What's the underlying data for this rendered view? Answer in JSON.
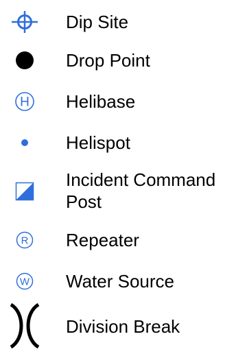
{
  "legend": {
    "items": [
      {
        "symbol": "dip-site-icon",
        "label": "Dip Site"
      },
      {
        "symbol": "drop-point-icon",
        "label": "Drop Point"
      },
      {
        "symbol": "helibase-icon",
        "label": "Helibase",
        "glyph": "H"
      },
      {
        "symbol": "helispot-icon",
        "label": "Helispot"
      },
      {
        "symbol": "incident-command-post-icon",
        "label": "Incident Command Post"
      },
      {
        "symbol": "repeater-icon",
        "label": "Repeater",
        "glyph": "R"
      },
      {
        "symbol": "water-source-icon",
        "label": "Water Source",
        "glyph": "W"
      },
      {
        "symbol": "division-break-icon",
        "label": "Division Break"
      }
    ],
    "colors": {
      "blue": "#2f6fdc",
      "black": "#000000"
    }
  }
}
